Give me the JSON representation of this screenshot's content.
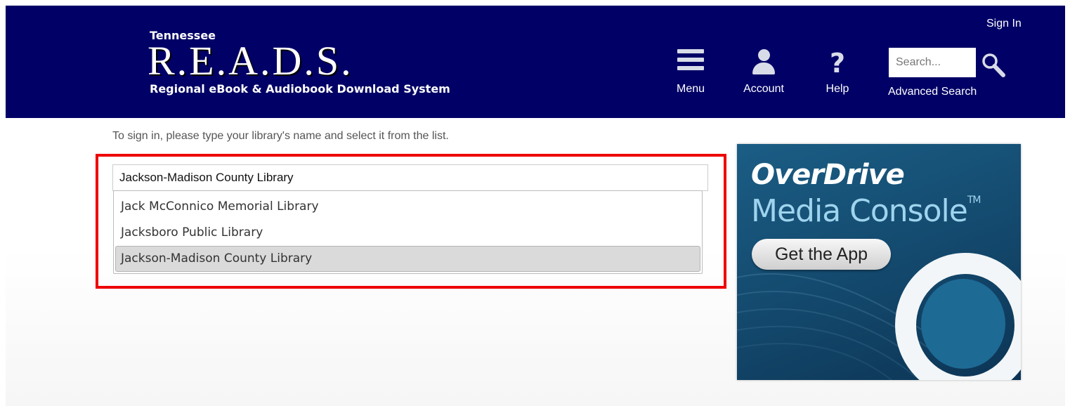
{
  "header": {
    "logo_state": "Tennessee",
    "logo_name": "R.E.A.D.S.",
    "logo_tagline": "Regional eBook & Audiobook Download System",
    "sign_in": "Sign In",
    "nav": [
      {
        "label": "Menu",
        "icon": "menu-icon"
      },
      {
        "label": "Account",
        "icon": "account-icon"
      },
      {
        "label": "Help",
        "icon": "help-icon"
      }
    ],
    "search": {
      "placeholder": "Search...",
      "value": "",
      "icon": "search-icon"
    },
    "advanced_search": "Advanced Search",
    "colors": {
      "background": "#010066",
      "text": "#ffffff"
    }
  },
  "signin_form": {
    "instructions": "To sign in, please type your library's name and select it from the list.",
    "library_input_value": "Jackson-Madison County Library",
    "suggestions": [
      {
        "label": "Jack McConnico Memorial Library",
        "selected": false
      },
      {
        "label": "Jacksboro Public Library",
        "selected": false
      },
      {
        "label": "Jackson-Madison County Library",
        "selected": true
      }
    ],
    "highlight_color": "#ee0000"
  },
  "ad": {
    "brand": "OverDrive",
    "product": "Media Console",
    "trademark": "TM",
    "button": "Get the App"
  }
}
